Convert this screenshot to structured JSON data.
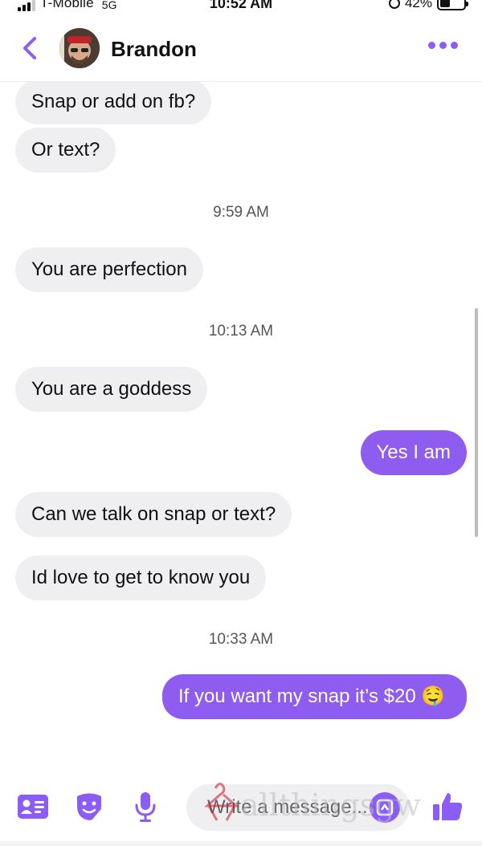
{
  "status_bar": {
    "carrier": "T-Mobile",
    "network": "5G",
    "time": "10:52 AM",
    "battery": "42%",
    "battery_level": 0.42
  },
  "header": {
    "contact_name": "Brandon",
    "back_icon": "chevron-left-icon",
    "more_icon": "more-dots-icon",
    "accent_color": "#8b5cf6"
  },
  "messages": [
    {
      "type": "incoming",
      "text": "Snap or add on fb?"
    },
    {
      "type": "incoming",
      "text": "Or text?"
    },
    {
      "type": "timestamp",
      "text": "9:59 AM"
    },
    {
      "type": "incoming",
      "text": "You are perfection"
    },
    {
      "type": "timestamp",
      "text": "10:13 AM"
    },
    {
      "type": "incoming",
      "text": "You are a goddess"
    },
    {
      "type": "outgoing",
      "text": "Yes I am"
    },
    {
      "type": "incoming",
      "text": "Can we talk on snap or text?"
    },
    {
      "type": "incoming",
      "text": "Id love to get to know you"
    },
    {
      "type": "timestamp",
      "text": "10:33 AM"
    },
    {
      "type": "outgoing",
      "text": "If you want my snap it’s $20 🤤"
    }
  ],
  "composer": {
    "placeholder": "Write a message...",
    "icons": [
      "contact-card-icon",
      "sticker-icon",
      "microphone-icon",
      "gif-sticker-icon",
      "thumbs-up-icon"
    ]
  },
  "watermark": {
    "text": "allthingsgw"
  },
  "colors": {
    "incoming_bubble": "#efeff1",
    "outgoing_bubble": "#8f5cf0"
  }
}
